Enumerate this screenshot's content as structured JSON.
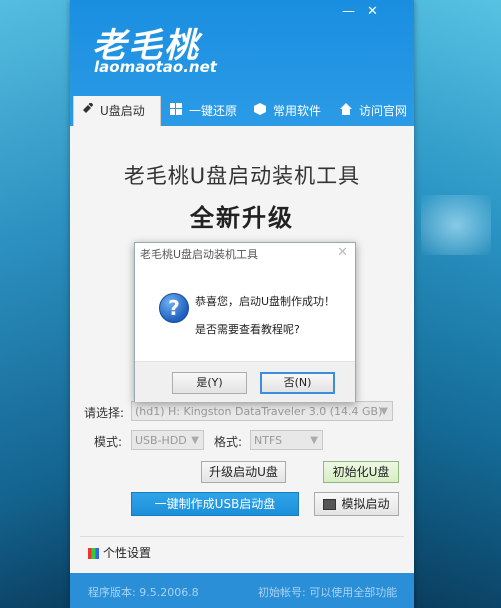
{
  "window": {
    "minimize_glyph": "—",
    "close_glyph": "✕",
    "logo_cn": "老毛桃",
    "logo_en": "laomaotao.net"
  },
  "tabs": [
    {
      "label": "U盘启动",
      "icon": "usb-icon",
      "active": true
    },
    {
      "label": "一键还原",
      "icon": "windows-icon",
      "active": false
    },
    {
      "label": "常用软件",
      "icon": "box-icon",
      "active": false
    },
    {
      "label": "访问官网",
      "icon": "home-icon",
      "active": false
    }
  ],
  "main": {
    "title": "老毛桃U盘启动装机工具",
    "subtitle": "全新升级"
  },
  "form": {
    "select_label": "请选择:",
    "select_value": "(hd1) H: Kingston DataTraveler 3.0 (14.4 GB)",
    "mode_label": "模式:",
    "mode_value": "USB-HDD",
    "format_label": "格式:",
    "format_value": "NTFS",
    "upgrade_button": "升级启动U盘",
    "init_button": "初始化U盘",
    "make_button": "一键制作成USB启动盘",
    "simulate_button": "模拟启动"
  },
  "settings_label": "个性设置",
  "status": {
    "version": "程序版本: 9.5.2006.8",
    "tip": "初始帐号: 可以使用全部功能"
  },
  "dialog": {
    "title": "老毛桃U盘启动装机工具",
    "message1": "恭喜您，启动U盘制作成功！",
    "message2": "是否需要查看教程呢?",
    "yes_button": "是(Y)",
    "no_button": "否(N)",
    "icon": "question-icon"
  },
  "colors": {
    "header_blue": "#1a8ee0",
    "primary_button": "#1c8fd9",
    "status_bar": "#2a8fd6"
  }
}
